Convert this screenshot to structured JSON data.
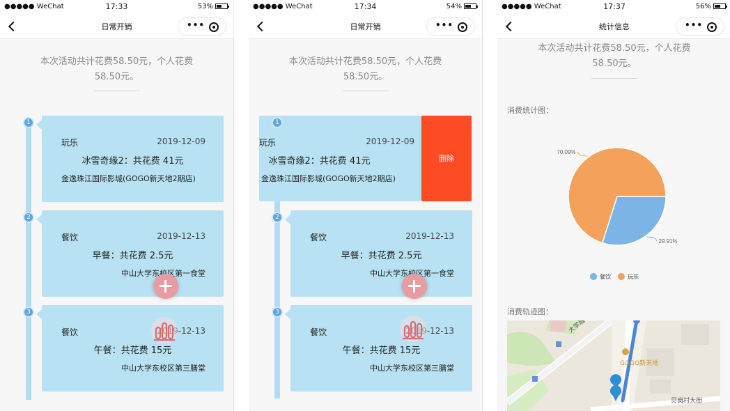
{
  "status": {
    "carrier": "●●●●● WeChat",
    "screens": [
      {
        "time": "17:33",
        "battery": "53%",
        "battery_level": 0.53
      },
      {
        "time": "17:34",
        "battery": "54%",
        "battery_level": 0.54
      },
      {
        "time": "17:37",
        "battery": "56%",
        "battery_level": 0.56
      }
    ]
  },
  "nav": {
    "list_title": "日常开销",
    "stats_title": "统计信息",
    "more_glyph": "•••",
    "back_icon": "chevron-left-icon",
    "capsule_icon": "target-icon"
  },
  "summary": {
    "line1": "本次活动共计花费58.50元，个人花费",
    "line2": "58.50元。"
  },
  "entries": [
    {
      "index": "1",
      "category": "玩乐",
      "date": "2019-12-09",
      "title": "冰雪奇缘2：共花费 41元",
      "location": "金逸珠江国际影城(GOGO新天地2期店)"
    },
    {
      "index": "2",
      "category": "餐饮",
      "date": "2019-12-13",
      "title": "早餐：共花费 2.5元",
      "location": "中山大学东校区第一食堂"
    },
    {
      "index": "3",
      "category": "餐饮",
      "date": "2019-12-13",
      "title": "午餐：共花费 15元",
      "location": "中山大学东校区第三膳堂"
    }
  ],
  "delete_label": "删除",
  "colors": {
    "card": "#b8e2f3",
    "badge": "#5ea6dd",
    "delete": "#fd4b24",
    "fab": "#e89ba0",
    "food": "#7cb4e8",
    "fun": "#f4a15c"
  },
  "stats": {
    "chart_label": "消费统计图：",
    "track_label": "消费轨迹图："
  },
  "chart_data": {
    "type": "pie",
    "title": "",
    "legend_position": "bottom",
    "series": [
      {
        "name": "餐饮",
        "value": 29.91,
        "label": "29.91%",
        "color": "#7cb4e8"
      },
      {
        "name": "玩乐",
        "value": 70.09,
        "label": "70.09%",
        "color": "#f4a15c"
      }
    ]
  },
  "map": {
    "road_label": "贝岗村大街",
    "uni_label": "大学城中环东",
    "poi_label": "GOGO新天地"
  }
}
